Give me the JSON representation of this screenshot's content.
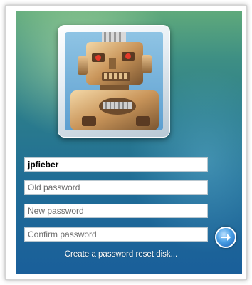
{
  "user": {
    "username": "jpfieber",
    "avatar_icon": "robot-icon"
  },
  "form": {
    "old_password_placeholder": "Old password",
    "new_password_placeholder": "New password",
    "confirm_password_placeholder": "Confirm password",
    "submit_icon": "arrow-right-icon"
  },
  "links": {
    "reset_disk": "Create a password reset disk..."
  },
  "colors": {
    "panel_top": "#5fa97b",
    "panel_bottom": "#1a5f9a",
    "submit_button": "#4aa0e6"
  }
}
